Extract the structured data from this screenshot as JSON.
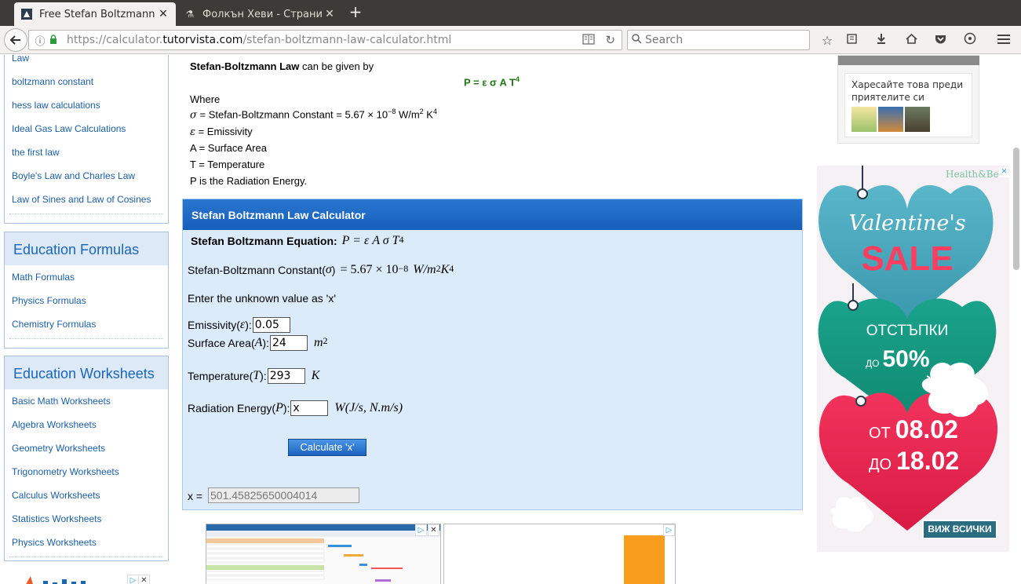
{
  "browser": {
    "tabs": [
      {
        "title": "Free Stefan Boltzmann",
        "active": true
      },
      {
        "title": "Фолкън Хеви - Страни",
        "active": false
      }
    ],
    "url_prefix": "https://calculator.",
    "url_domain": "tutorvista.com",
    "url_path": "/stefan-boltzmann-law-calculator.html",
    "search_placeholder": "Search"
  },
  "sidebar": {
    "top_links": [
      "Law",
      "boltzmann constant",
      "hess law calculations",
      "Ideal Gas Law Calculations",
      "the first law",
      "Boyle's Law and Charles Law",
      "Law of Sines and Law of Cosines"
    ],
    "formulas": {
      "heading": "Education Formulas",
      "links": [
        "Math Formulas",
        "Physics Formulas",
        "Chemistry Formulas"
      ]
    },
    "worksheets": {
      "heading": "Education Worksheets",
      "links": [
        "Basic Math Worksheets",
        "Algebra Worksheets",
        "Geometry Worksheets",
        "Trigonometry Worksheets",
        "Calculus Worksheets",
        "Statistics Worksheets",
        "Physics Worksheets"
      ]
    }
  },
  "intro": {
    "law_name": "Stefan-Boltzmann Law",
    "law_suffix": " can be given by",
    "formula_main": "P = ε σ A  T",
    "formula_exp": "4",
    "where": "Where",
    "sigma_def_a": " = Stefan-Boltzmann Constant = 5.67 × 10",
    "sigma_exp": "−8",
    "sigma_def_b": " W/m",
    "sigma_def_c": "2",
    "sigma_def_d": " K",
    "sigma_def_e": "4",
    "epsilon_def": " = Emissivity",
    "area_def": "A = Surface Area",
    "temp_def": "T = Temperature",
    "power_def": "P is the Radiation Energy."
  },
  "calculator": {
    "title": "Stefan Boltzmann Law Calculator",
    "eq_label": "Stefan Boltzmann Equation:",
    "eq_math": "P  =  ε A σ T",
    "eq_exp": "4",
    "const_label": "Stefan-Boltzmann Constant(",
    "const_sym": "σ",
    "const_close": ")",
    "const_value": "=  5.67 × 10",
    "const_exp": "−8",
    "const_unit_a": "W/m",
    "const_unit_b": "2",
    "const_unit_c": " K",
    "const_unit_d": "4",
    "instruction": "Enter the unknown value as  'x'",
    "emissivity_label": "Emissivity(",
    "emissivity_sym": "ε",
    "emissivity_value": "0.05",
    "area_label": "Surface Area(",
    "area_sym": "A",
    "area_value": "24",
    "area_unit": "m",
    "area_unit_exp": "2",
    "temp_label": "Temperature(",
    "temp_sym": "T",
    "temp_value": "293",
    "temp_unit": "K",
    "energy_label": "Radiation Energy(",
    "energy_sym": "P",
    "energy_value": "x",
    "energy_unit": "W(J/s, N.m/s)",
    "close_paren": "):",
    "button_label": "Calculate 'x'",
    "result_label": "x =",
    "result_value": "501.45825650004014"
  },
  "facebook_box": {
    "text": "Харесайте това преди приятелите си"
  },
  "valentine_ad": {
    "brand": "Health&Beauty",
    "line1": "Valentine's",
    "line2": "SALE",
    "line3": "ОТСТЪПКИ",
    "line4_prefix": "ДО",
    "line4": "50%",
    "line5_prefix": "ОТ",
    "line5": "08.02",
    "line6_prefix": "ДО",
    "line6": "18.02",
    "button": "ВИЖ ВСИЧКИ"
  },
  "colors": {
    "link": "#1a5ea8",
    "calc_bg": "#dcebfa",
    "calc_header": "#1d68c4",
    "formula_green": "#1f7a12",
    "sidebar_head_bg": "#dde9f7"
  }
}
